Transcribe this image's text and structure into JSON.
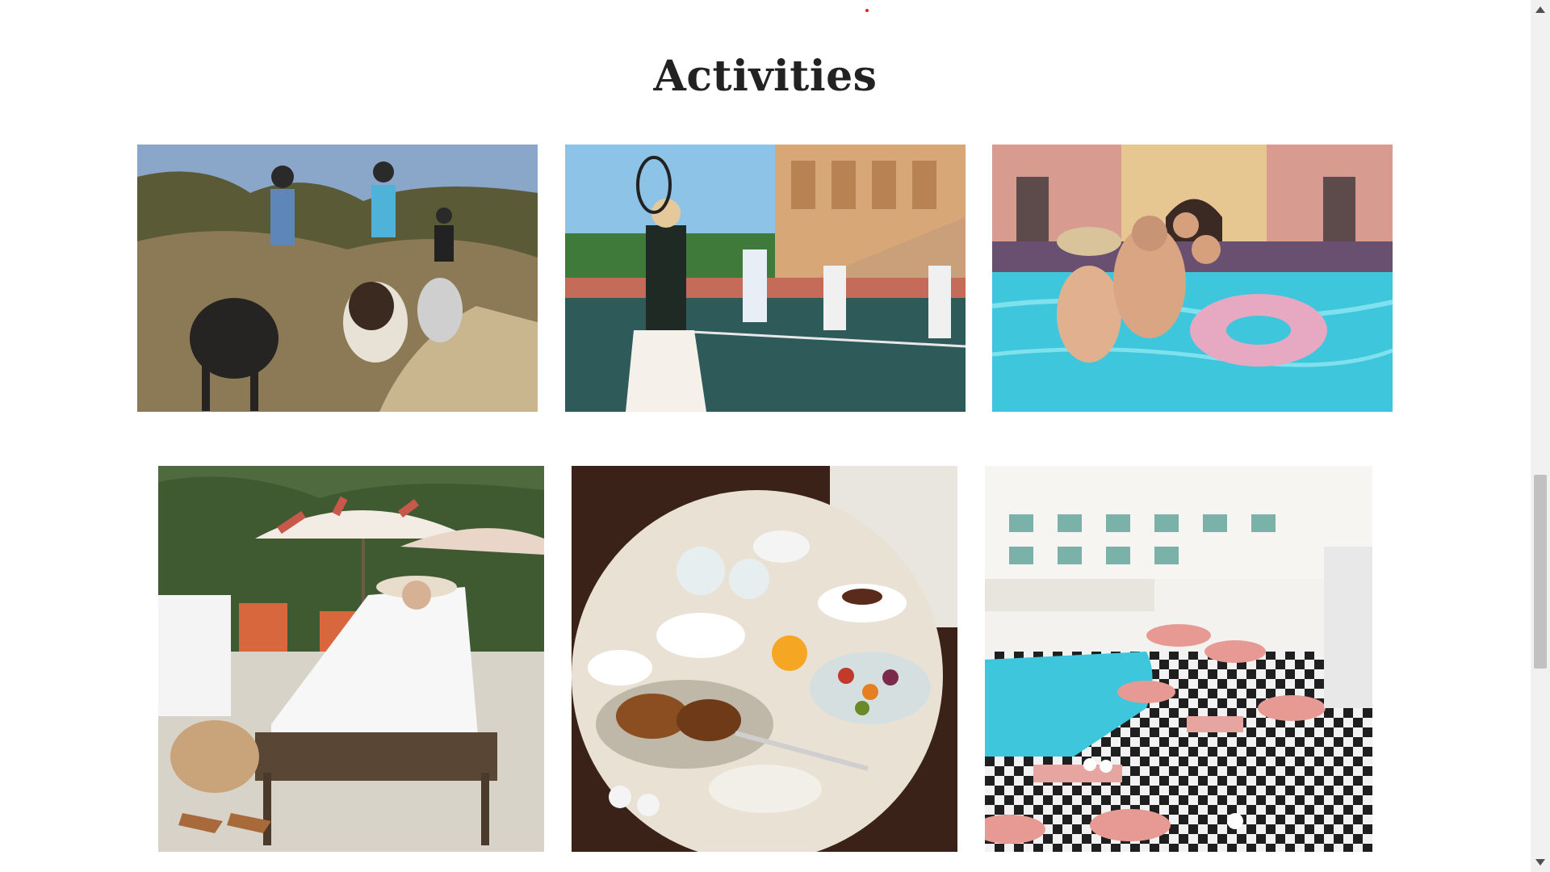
{
  "section": {
    "title": "Activities"
  },
  "gallery": [
    {
      "subject": "horseback-riding"
    },
    {
      "subject": "tennis"
    },
    {
      "subject": "family-pool"
    },
    {
      "subject": "poolside-lounge"
    },
    {
      "subject": "breakfast-table"
    },
    {
      "subject": "hotel-courtyard-pool"
    }
  ],
  "colors": {
    "title": "#222222",
    "accent_dot": "#e02424",
    "pool": "#3ec7dc"
  }
}
